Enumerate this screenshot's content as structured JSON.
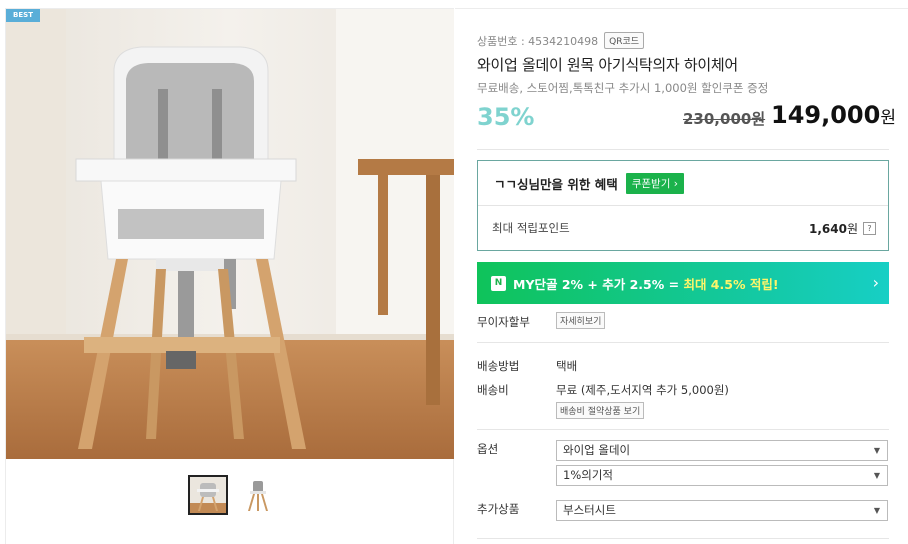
{
  "badge": "BEST",
  "product": {
    "number_label": "상품번호 : 4534210498",
    "qr_label": "QR코드",
    "title": "와이업 올데이 원목 아기식탁의자 하이체어",
    "promo": "무료배송, 스토어찜,톡톡친구 추가시 1,000원 할인쿠폰 증정",
    "discount": "35%",
    "original_price": "230,000원",
    "price": "149,000",
    "price_unit": "원"
  },
  "benefit": {
    "title": "ㄱㄱ싱님만을 위한 혜택",
    "coupon_button": "쿠폰받기",
    "point_label": "최대 적립포인트",
    "point_value": "1,640",
    "point_unit": "원",
    "help": "?"
  },
  "banner": {
    "icon": "N",
    "text_main": "MY단골 2% + 추가 2.5% = ",
    "text_highlight": "최대 4.5% 적립!",
    "arrow": "›"
  },
  "installment": {
    "label": "무이자할부",
    "button": "자세히보기"
  },
  "delivery": {
    "method_label": "배송방법",
    "method_value": "택배",
    "fee_label": "배송비",
    "fee_value": "무료 (제주,도서지역 추가 5,000원)",
    "fee_button": "배송비 절약상품 보기"
  },
  "options": {
    "label": "옵션",
    "select1": "와이업 올데이",
    "select2": "1%의기적"
  },
  "addon": {
    "label": "추가상품",
    "select": "부스터시트"
  },
  "colors": {
    "accent_green": "#1bb24b",
    "discount": "#7fd3cf",
    "badge": "#5aaed8",
    "highlight": "#fff56a"
  }
}
